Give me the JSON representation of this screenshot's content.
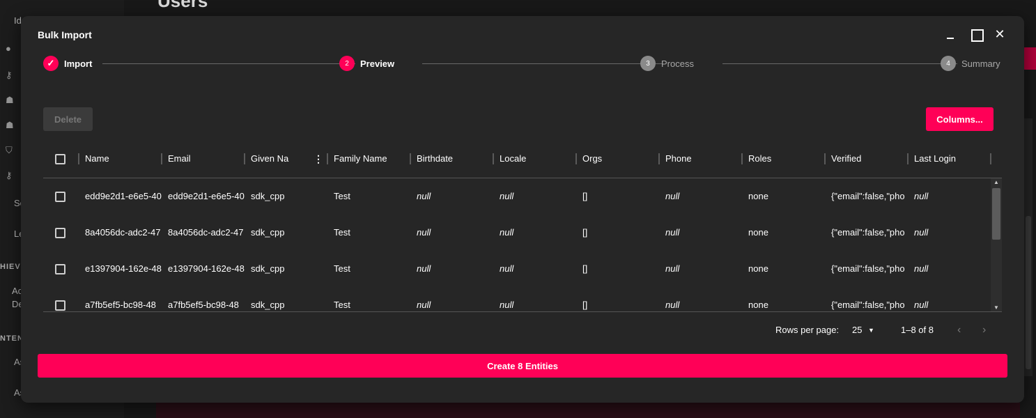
{
  "background": {
    "page_title": "Users",
    "sidebar_items": [
      "Id",
      "Se",
      "Le",
      "Ac",
      "De",
      "As",
      "As"
    ],
    "sidebar_heads": [
      "HIEVI",
      "NTEN"
    ]
  },
  "dialog": {
    "title": "Bulk Import",
    "controls": {
      "minimize": "",
      "maximize": "",
      "close": "✕"
    }
  },
  "stepper": {
    "steps": [
      {
        "label": "Import",
        "state": "done",
        "marker": "✓"
      },
      {
        "label": "Preview",
        "state": "active",
        "marker": "2"
      },
      {
        "label": "Process",
        "state": "pending",
        "marker": "3"
      },
      {
        "label": "Summary",
        "state": "pending",
        "marker": "4"
      }
    ]
  },
  "toolbar": {
    "delete_label": "Delete",
    "columns_label": "Columns..."
  },
  "table": {
    "columns": [
      "Name",
      "Email",
      "Given Na",
      "Family Name",
      "Birthdate",
      "Locale",
      "Orgs",
      "Phone",
      "Roles",
      "Verified",
      "Last Login"
    ],
    "rows": [
      [
        "edd9e2d1-e6e5-40",
        "edd9e2d1-e6e5-40",
        "sdk_cpp",
        "Test",
        "null",
        "null",
        "[]",
        "null",
        "none",
        "{\"email\":false,\"pho",
        "null"
      ],
      [
        "8a4056dc-adc2-47",
        "8a4056dc-adc2-47",
        "sdk_cpp",
        "Test",
        "null",
        "null",
        "[]",
        "null",
        "none",
        "{\"email\":false,\"pho",
        "null"
      ],
      [
        "e1397904-162e-48",
        "e1397904-162e-48",
        "sdk_cpp",
        "Test",
        "null",
        "null",
        "[]",
        "null",
        "none",
        "{\"email\":false,\"pho",
        "null"
      ],
      [
        "a7fb5ef5-bc98-48",
        "a7fb5ef5-bc98-48",
        "sdk_cpp",
        "Test",
        "null",
        "null",
        "[]",
        "null",
        "none",
        "{\"email\":false,\"pho",
        "null"
      ]
    ]
  },
  "pagination": {
    "rows_per_page_label": "Rows per page:",
    "rows_per_page_value": "25",
    "range": "1–8 of 8",
    "prev": "‹",
    "next": "›"
  },
  "create_button_label": "Create 8 Entities",
  "colors": {
    "accent": "#ff0057",
    "dialog_bg": "#262626",
    "disabled_button": "#3b3b3b"
  }
}
